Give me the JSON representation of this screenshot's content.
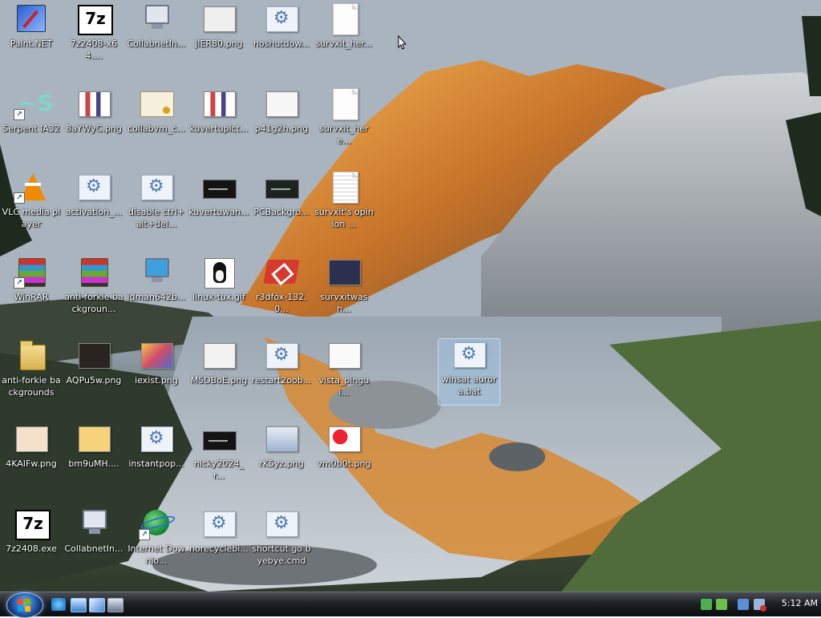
{
  "desktop": {
    "icons": [
      {
        "label": "Paint.NET"
      },
      {
        "label": "7z2408-x64...."
      },
      {
        "label": "CollabnetIn..."
      },
      {
        "label": "jlER80.png"
      },
      {
        "label": "noshutdow..."
      },
      {
        "label": "survxit_her..."
      },
      {
        "label": "Serpent IA32"
      },
      {
        "label": "8aYWyC.png"
      },
      {
        "label": "collabvm_c..."
      },
      {
        "label": "kuvertupict..."
      },
      {
        "label": "p41g2h.png"
      },
      {
        "label": "survxit_here..."
      },
      {
        "label": "VLC media player"
      },
      {
        "label": "activation_..."
      },
      {
        "label": "disable ctrl+alt+del..."
      },
      {
        "label": "kuvertuwan..."
      },
      {
        "label": "PCBackgro..."
      },
      {
        "label": "survxit's opinion ..."
      },
      {
        "label": "WinRAR"
      },
      {
        "label": "anti-forkie backgroun..."
      },
      {
        "label": "idman642b..."
      },
      {
        "label": "linux-tux.gif"
      },
      {
        "label": "r3dfox-132.0..."
      },
      {
        "label": "survxitwash..."
      },
      {
        "label": "anti-forkie backgrounds"
      },
      {
        "label": "AQPu5w.png"
      },
      {
        "label": "iexist.png"
      },
      {
        "label": "M5DBoE.png"
      },
      {
        "label": "restart2oob..."
      },
      {
        "label": "vista_pingui..."
      },
      {
        "label": "winsat aurora.bat"
      },
      {
        "label": "4KAIFw.png"
      },
      {
        "label": "bm9uMH...."
      },
      {
        "label": "instantpop..."
      },
      {
        "label": "nicky2024_r..."
      },
      {
        "label": "rK5yz.png"
      },
      {
        "label": "vm0b0t.png"
      },
      {
        "label": "7z2408.exe"
      },
      {
        "label": "CollabnetIn..."
      },
      {
        "label": "Internet Downlo..."
      },
      {
        "label": "norecyclebi..."
      },
      {
        "label": "shortcut go byebye.cmd"
      }
    ]
  },
  "taskbar": {
    "clock": "5:12 AM"
  }
}
